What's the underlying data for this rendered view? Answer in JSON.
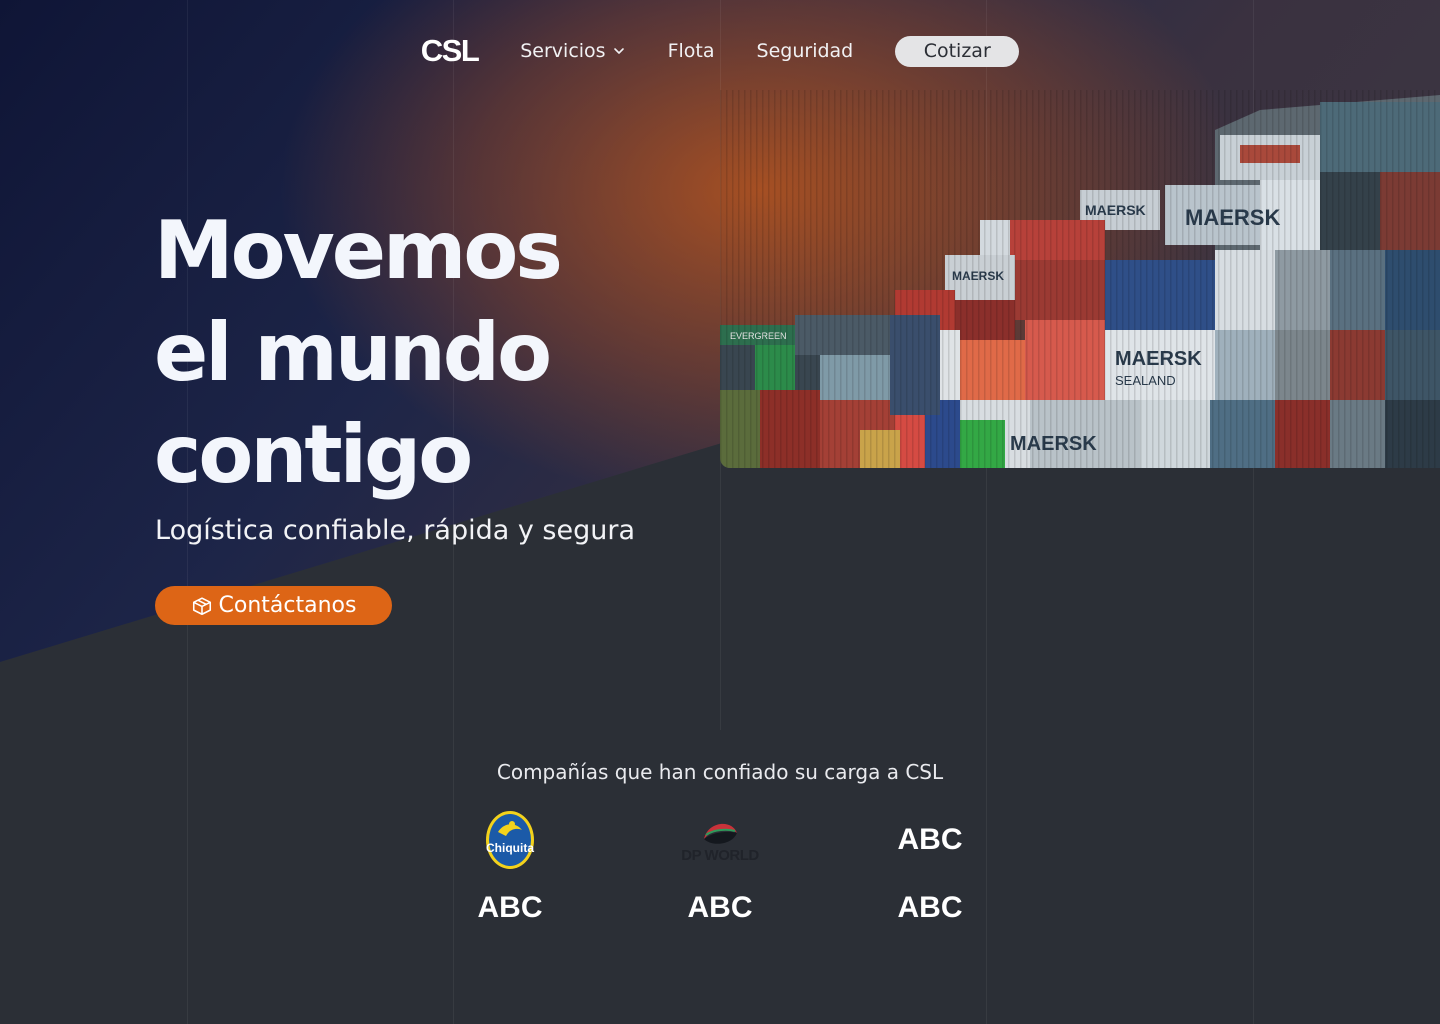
{
  "nav": {
    "logo": "CSL",
    "links": [
      {
        "label": "Servicios",
        "has_dropdown": true
      },
      {
        "label": "Flota"
      },
      {
        "label": "Seguridad"
      }
    ],
    "cta_label": "Cotizar"
  },
  "hero": {
    "title_lines": [
      "Movemos",
      "el mundo",
      "contigo"
    ],
    "subtitle": "Logística confiable, rápida y segura",
    "cta_label": "Contáctanos",
    "cta_icon": "box-icon",
    "image_alt": "stacked-shipping-containers",
    "container_labels": [
      "MAERSK",
      "MAERSK SEALAND",
      "EVERGREEN"
    ]
  },
  "partners": {
    "title": "Compañías que han confiado su carga a CSL",
    "logos": [
      {
        "name": "Chiquita",
        "type": "chiquita-logo"
      },
      {
        "name": "DP WORLD",
        "type": "dp-world-logo"
      },
      {
        "name": "ABC",
        "type": "text"
      },
      {
        "name": "ABC",
        "type": "text"
      },
      {
        "name": "ABC",
        "type": "text"
      },
      {
        "name": "ABC",
        "type": "text"
      }
    ]
  },
  "colors": {
    "accent": "#dd6516",
    "background": "#2b2f36",
    "hero_dark": "#0f1536",
    "cotizar_bg": "#e4e4e6"
  }
}
